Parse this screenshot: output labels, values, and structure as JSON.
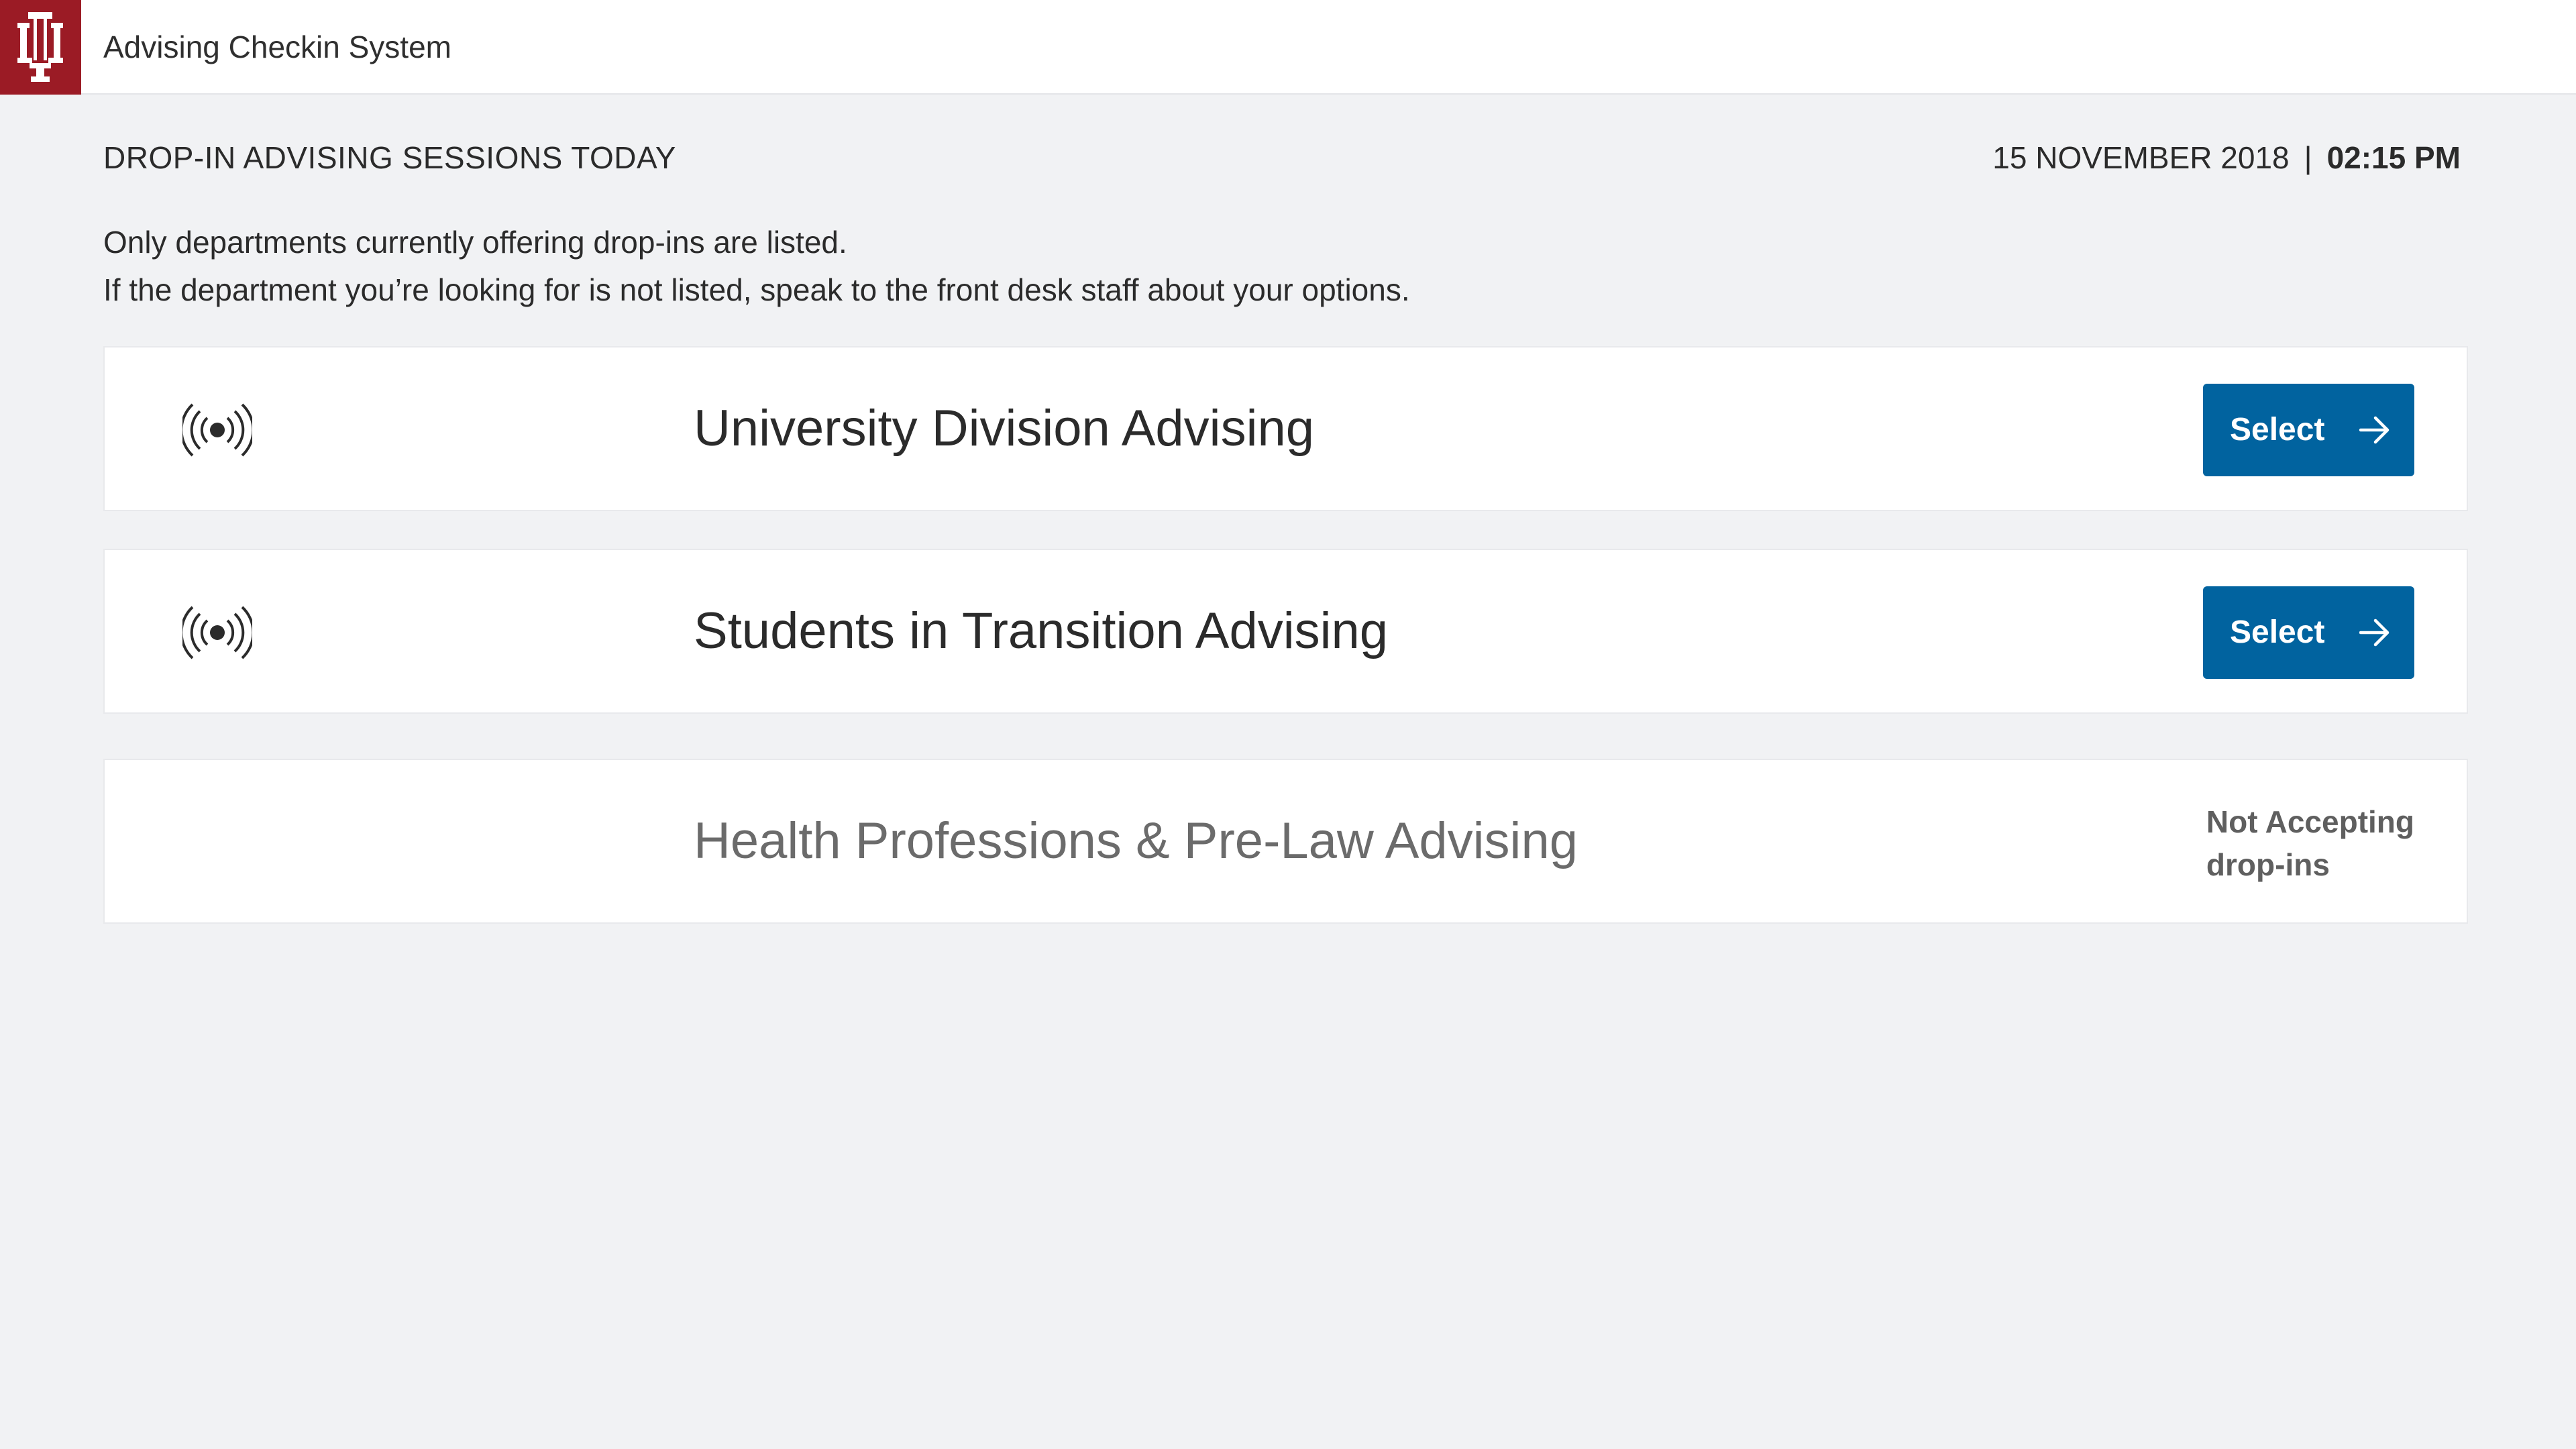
{
  "header": {
    "logo_icon": "iu-trident-icon",
    "app_title": "Advising Checkin System",
    "brand_color": "#9b1b25"
  },
  "main": {
    "heading": "DROP-IN ADVISING SESSIONS TODAY",
    "date": "15 NOVEMBER 2018",
    "separator": "|",
    "time": "02:15 PM",
    "info_line_1": "Only departments currently offering drop-ins are listed.",
    "info_line_2": "If the department you’re looking for is not listed, speak to the front desk staff about your options."
  },
  "departments": [
    {
      "name": "University Division Advising",
      "status_icon": "broadcast-signal-icon",
      "action_label": "Select",
      "action_icon": "arrow-right-icon"
    },
    {
      "name": "Students in Transition Advising",
      "status_icon": "broadcast-signal-icon",
      "action_label": "Select",
      "action_icon": "arrow-right-icon"
    },
    {
      "name": "Health Professions & Pre-Law Advising",
      "status_line_1": "Not Accepting",
      "status_line_2": "drop-ins"
    }
  ],
  "colors": {
    "accent": "#01639f",
    "background": "#f1f2f4"
  }
}
